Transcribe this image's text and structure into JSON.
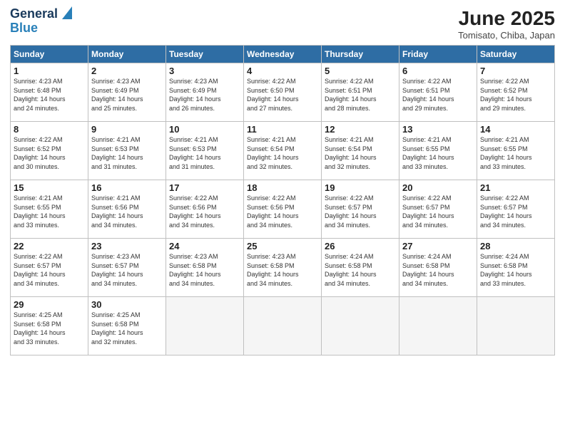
{
  "header": {
    "logo_line1": "General",
    "logo_line2": "Blue",
    "month": "June 2025",
    "location": "Tomisato, Chiba, Japan"
  },
  "days_of_week": [
    "Sunday",
    "Monday",
    "Tuesday",
    "Wednesday",
    "Thursday",
    "Friday",
    "Saturday"
  ],
  "weeks": [
    [
      {
        "day": "1",
        "info": "Sunrise: 4:23 AM\nSunset: 6:48 PM\nDaylight: 14 hours\nand 24 minutes."
      },
      {
        "day": "2",
        "info": "Sunrise: 4:23 AM\nSunset: 6:49 PM\nDaylight: 14 hours\nand 25 minutes."
      },
      {
        "day": "3",
        "info": "Sunrise: 4:23 AM\nSunset: 6:49 PM\nDaylight: 14 hours\nand 26 minutes."
      },
      {
        "day": "4",
        "info": "Sunrise: 4:22 AM\nSunset: 6:50 PM\nDaylight: 14 hours\nand 27 minutes."
      },
      {
        "day": "5",
        "info": "Sunrise: 4:22 AM\nSunset: 6:51 PM\nDaylight: 14 hours\nand 28 minutes."
      },
      {
        "day": "6",
        "info": "Sunrise: 4:22 AM\nSunset: 6:51 PM\nDaylight: 14 hours\nand 29 minutes."
      },
      {
        "day": "7",
        "info": "Sunrise: 4:22 AM\nSunset: 6:52 PM\nDaylight: 14 hours\nand 29 minutes."
      }
    ],
    [
      {
        "day": "8",
        "info": "Sunrise: 4:22 AM\nSunset: 6:52 PM\nDaylight: 14 hours\nand 30 minutes."
      },
      {
        "day": "9",
        "info": "Sunrise: 4:21 AM\nSunset: 6:53 PM\nDaylight: 14 hours\nand 31 minutes."
      },
      {
        "day": "10",
        "info": "Sunrise: 4:21 AM\nSunset: 6:53 PM\nDaylight: 14 hours\nand 31 minutes."
      },
      {
        "day": "11",
        "info": "Sunrise: 4:21 AM\nSunset: 6:54 PM\nDaylight: 14 hours\nand 32 minutes."
      },
      {
        "day": "12",
        "info": "Sunrise: 4:21 AM\nSunset: 6:54 PM\nDaylight: 14 hours\nand 32 minutes."
      },
      {
        "day": "13",
        "info": "Sunrise: 4:21 AM\nSunset: 6:55 PM\nDaylight: 14 hours\nand 33 minutes."
      },
      {
        "day": "14",
        "info": "Sunrise: 4:21 AM\nSunset: 6:55 PM\nDaylight: 14 hours\nand 33 minutes."
      }
    ],
    [
      {
        "day": "15",
        "info": "Sunrise: 4:21 AM\nSunset: 6:55 PM\nDaylight: 14 hours\nand 33 minutes."
      },
      {
        "day": "16",
        "info": "Sunrise: 4:21 AM\nSunset: 6:56 PM\nDaylight: 14 hours\nand 34 minutes."
      },
      {
        "day": "17",
        "info": "Sunrise: 4:22 AM\nSunset: 6:56 PM\nDaylight: 14 hours\nand 34 minutes."
      },
      {
        "day": "18",
        "info": "Sunrise: 4:22 AM\nSunset: 6:56 PM\nDaylight: 14 hours\nand 34 minutes."
      },
      {
        "day": "19",
        "info": "Sunrise: 4:22 AM\nSunset: 6:57 PM\nDaylight: 14 hours\nand 34 minutes."
      },
      {
        "day": "20",
        "info": "Sunrise: 4:22 AM\nSunset: 6:57 PM\nDaylight: 14 hours\nand 34 minutes."
      },
      {
        "day": "21",
        "info": "Sunrise: 4:22 AM\nSunset: 6:57 PM\nDaylight: 14 hours\nand 34 minutes."
      }
    ],
    [
      {
        "day": "22",
        "info": "Sunrise: 4:22 AM\nSunset: 6:57 PM\nDaylight: 14 hours\nand 34 minutes."
      },
      {
        "day": "23",
        "info": "Sunrise: 4:23 AM\nSunset: 6:57 PM\nDaylight: 14 hours\nand 34 minutes."
      },
      {
        "day": "24",
        "info": "Sunrise: 4:23 AM\nSunset: 6:58 PM\nDaylight: 14 hours\nand 34 minutes."
      },
      {
        "day": "25",
        "info": "Sunrise: 4:23 AM\nSunset: 6:58 PM\nDaylight: 14 hours\nand 34 minutes."
      },
      {
        "day": "26",
        "info": "Sunrise: 4:24 AM\nSunset: 6:58 PM\nDaylight: 14 hours\nand 34 minutes."
      },
      {
        "day": "27",
        "info": "Sunrise: 4:24 AM\nSunset: 6:58 PM\nDaylight: 14 hours\nand 34 minutes."
      },
      {
        "day": "28",
        "info": "Sunrise: 4:24 AM\nSunset: 6:58 PM\nDaylight: 14 hours\nand 33 minutes."
      }
    ],
    [
      {
        "day": "29",
        "info": "Sunrise: 4:25 AM\nSunset: 6:58 PM\nDaylight: 14 hours\nand 33 minutes."
      },
      {
        "day": "30",
        "info": "Sunrise: 4:25 AM\nSunset: 6:58 PM\nDaylight: 14 hours\nand 32 minutes."
      },
      {
        "day": "",
        "info": ""
      },
      {
        "day": "",
        "info": ""
      },
      {
        "day": "",
        "info": ""
      },
      {
        "day": "",
        "info": ""
      },
      {
        "day": "",
        "info": ""
      }
    ]
  ]
}
